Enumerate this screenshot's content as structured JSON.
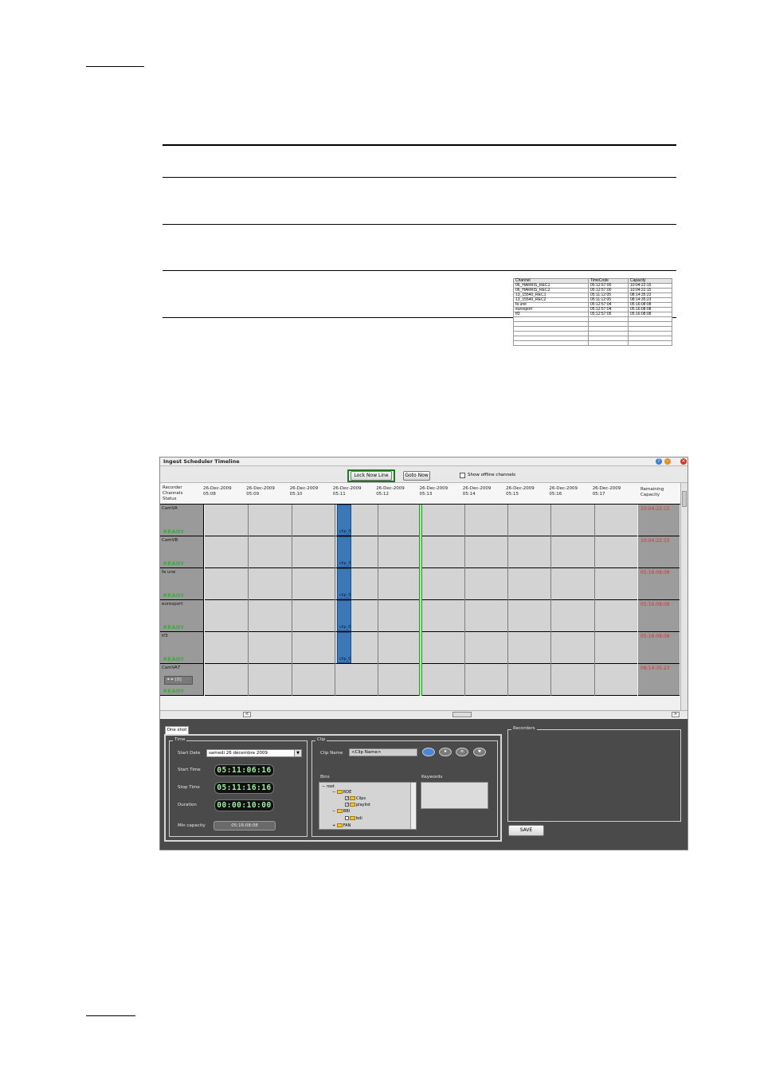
{
  "window": {
    "title": "Ingest Scheduler Timeline",
    "lock_now_line": "Lock Now Line",
    "goto_now": "Goto Now",
    "show_offline": "Show offline channels"
  },
  "grid": {
    "left_header": [
      "Recorder",
      "Channels",
      "Status"
    ],
    "right_header": [
      "Remaining",
      "Capacity"
    ],
    "time_headers": [
      {
        "date": "26-Dec-2009",
        "time": "05:08"
      },
      {
        "date": "26-Dec-2009",
        "time": "05:09"
      },
      {
        "date": "26-Dec-2009",
        "time": "05:10"
      },
      {
        "date": "26-Dec-2009",
        "time": "05:11"
      },
      {
        "date": "26-Dec-2009",
        "time": "05:12"
      },
      {
        "date": "26-Dec-2009",
        "time": "05:13"
      },
      {
        "date": "26-Dec-2009",
        "time": "05:14"
      },
      {
        "date": "26-Dec-2009",
        "time": "05:15"
      },
      {
        "date": "26-Dec-2009",
        "time": "05:16"
      },
      {
        "date": "26-Dec-2009",
        "time": "05:17"
      }
    ],
    "rows": [
      {
        "name": "CamVA",
        "status": "READY",
        "capacity": "10:04:22:15",
        "clip": "clip_0"
      },
      {
        "name": "CamVB",
        "status": "READY",
        "capacity": "10:04:22:15",
        "clip": "clip_0"
      },
      {
        "name": "fa une",
        "status": "READY",
        "capacity": "05:16:08:08",
        "clip": "clip_0"
      },
      {
        "name": "eurosport",
        "status": "READY",
        "capacity": "05:16:08:08",
        "clip": "clip_0"
      },
      {
        "name": "tf3",
        "status": "READY",
        "capacity": "05:16:08:08",
        "clip": "clip_0"
      },
      {
        "name": "CamVA7",
        "status": "READY",
        "capacity": "08:14:35:23",
        "clip": "",
        "badge": "[0]"
      }
    ]
  },
  "one_shot": {
    "tab": "One shot",
    "time": {
      "title": "Time",
      "start_date_label": "Start Date",
      "start_date": "samedi   26 décembre 2009",
      "start_time_label": "Start Time",
      "start_time": "05:11:06:16",
      "stop_time_label": "Stop Time",
      "stop_time": "05:11:16:16",
      "duration_label": "Duration",
      "duration": "00:00:10:00",
      "min_capacity_label": "Min capacity",
      "min_capacity": "05:16:08:08"
    },
    "clip": {
      "title": "Clip",
      "clip_name_label": "Clip Name",
      "clip_name": "<Clip Name>",
      "bins_label": "Bins",
      "keywords_label": "Keywords",
      "tree": [
        "root",
        "RDE",
        "Clips",
        "playlist",
        "BBI",
        "bdi",
        "FAN"
      ]
    }
  },
  "recorders": {
    "title": "Recorders",
    "columns": [
      "Channel",
      "TimeCode",
      "Capacity"
    ],
    "rows": [
      [
        "06_HARRIS_REC1",
        "05:12:57:00",
        "10:04:22:15"
      ],
      [
        "06_HARRIS_REC2",
        "05:12:57:00",
        "10:04:22:15"
      ],
      [
        "13_15540_REC1",
        "05:11:12:05",
        "08:14:35:23"
      ],
      [
        "13_15540_REC2",
        "05:11:12:05",
        "08:14:35:23"
      ],
      [
        "fa une",
        "05:12:57:04",
        "05:16:08:08"
      ],
      [
        "eurosport",
        "05:12:57:04",
        "05:16:08:08"
      ],
      [
        "tf3",
        "05:12:57:05",
        "05:16:08:08"
      ]
    ],
    "save": "SAVE"
  },
  "colors": {
    "ready": "#3ea83e",
    "capacity": "#e03030",
    "clip": "#3a78b8",
    "now_line": "#2aa02a",
    "highlight": "#1f7a1f"
  }
}
